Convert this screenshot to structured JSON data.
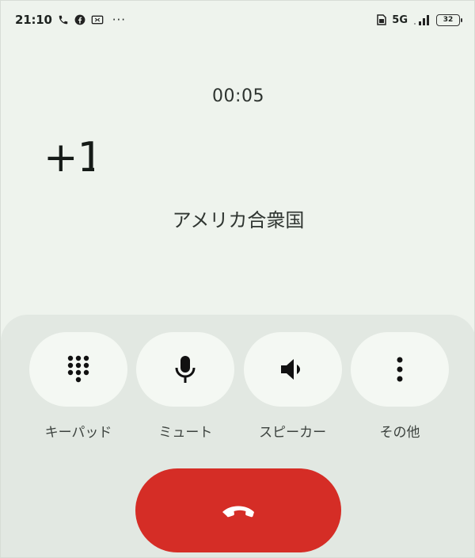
{
  "status_bar": {
    "time": "21:10",
    "left_icons": [
      "phone-icon",
      "facebook-icon",
      "cast-icon"
    ],
    "more": "···",
    "network": "5G",
    "battery": "32"
  },
  "call": {
    "timer": "00:05",
    "number": "+1",
    "location": "アメリカ合衆国"
  },
  "actions": [
    {
      "label": "キーパッド",
      "icon": "keypad-icon"
    },
    {
      "label": "ミュート",
      "icon": "microphone-icon"
    },
    {
      "label": "スピーカー",
      "icon": "speaker-icon"
    },
    {
      "label": "その他",
      "icon": "more-vertical-icon"
    }
  ],
  "end_call": {
    "icon": "end-call-icon"
  },
  "colors": {
    "background": "#eef3ed",
    "panel": "#e2e8e2",
    "button": "#f4f8f3",
    "end_call": "#d52d26"
  }
}
